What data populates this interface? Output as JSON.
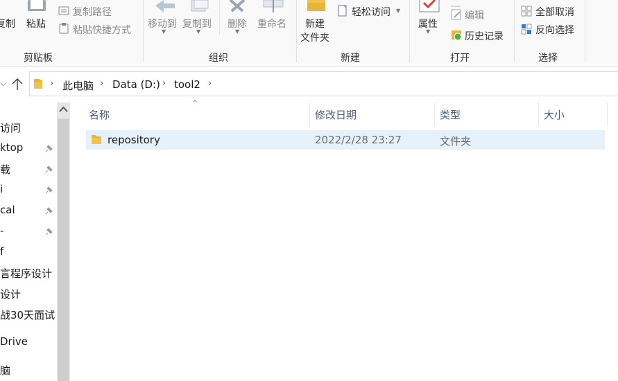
{
  "ribbon": {
    "clipboard": {
      "copy_label": "复制",
      "paste_label": "粘贴",
      "copy_path_label": "复制路径",
      "paste_shortcut_label": "粘贴快捷方式",
      "group_label": "剪贴板"
    },
    "organize": {
      "move_to_label": "移动到",
      "copy_to_label": "复制到",
      "delete_label": "删除",
      "rename_label": "重命名",
      "group_label": "组织"
    },
    "new": {
      "new_folder_line1": "新建",
      "new_folder_line2": "文件夹",
      "easy_access_label": "轻松访问",
      "group_label": "新建"
    },
    "open": {
      "properties_label": "属性",
      "edit_label": "编辑",
      "history_label": "历史记录",
      "group_label": "打开"
    },
    "select": {
      "select_all_label": "全部取消",
      "invert_label": "反向选择",
      "group_label": "选择"
    }
  },
  "address": {
    "crumbs": [
      "此电脑",
      "Data (D:)",
      "tool2"
    ]
  },
  "nav": {
    "items": [
      "访问",
      "ktop",
      "载",
      "i",
      "cal",
      "-",
      "f",
      "言程序设计",
      "设计",
      "战30天面试",
      "Drive",
      "脑"
    ]
  },
  "columns": {
    "name": "名称",
    "modified": "修改日期",
    "type": "类型",
    "size": "大小"
  },
  "files": [
    {
      "name": "repository",
      "modified": "2022/2/28 23:27",
      "type": "文件夹",
      "size": ""
    }
  ],
  "colors": {
    "selection": "#e5f1fb",
    "folder": "#e8b53c",
    "header_text": "#4c607a"
  }
}
